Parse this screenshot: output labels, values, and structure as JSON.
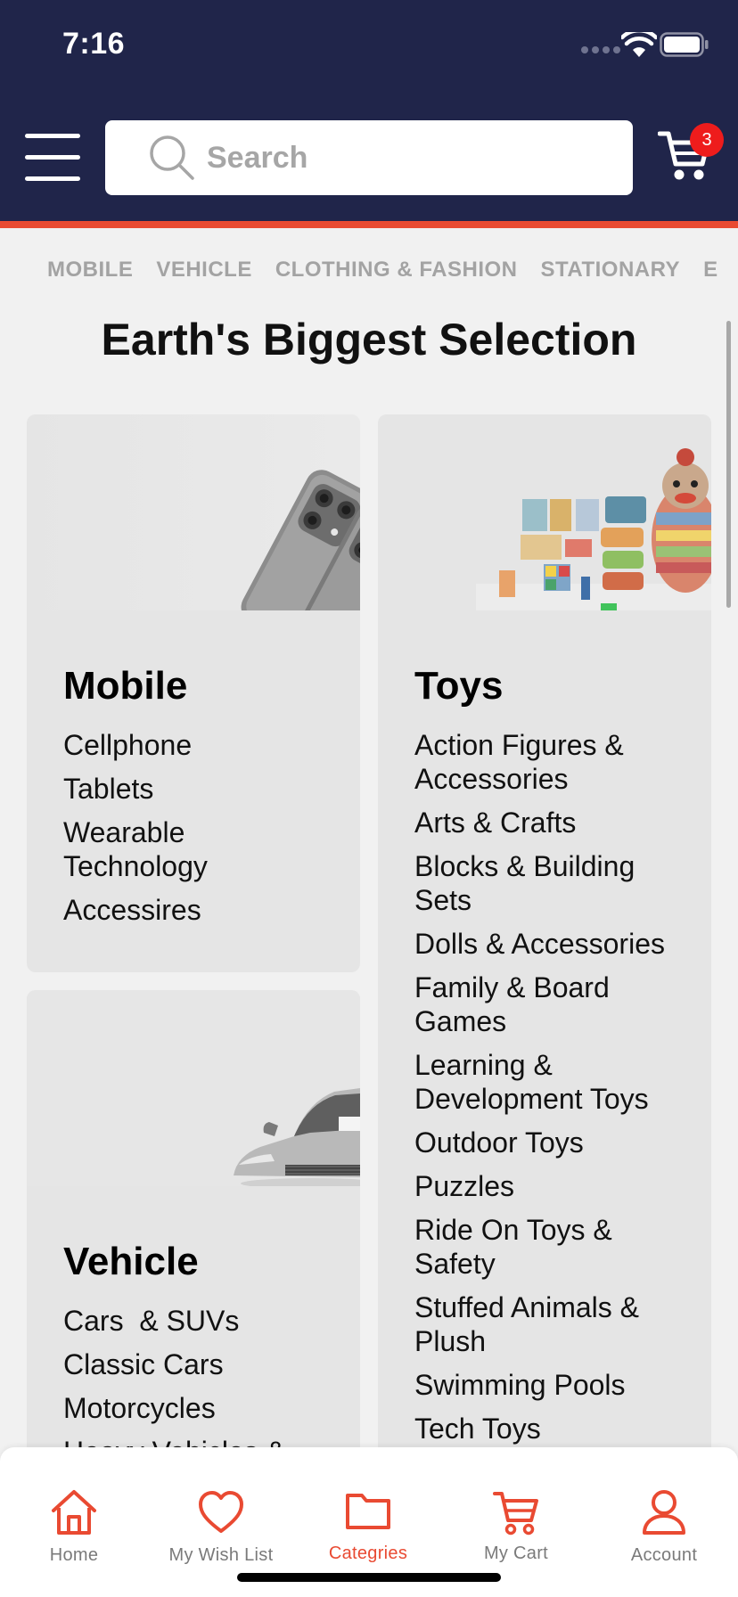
{
  "status_bar": {
    "time": "7:16"
  },
  "header": {
    "search_placeholder": "Search",
    "cart_count": "3"
  },
  "category_tabs": [
    "MOBILE",
    "VEHICLE",
    "CLOTHING & FASHION",
    "STATIONARY",
    "E"
  ],
  "page_title": "Earth's Biggest Selection",
  "cards": {
    "mobile": {
      "title": "Mobile",
      "items": [
        "Cellphone",
        "Tablets",
        "Wearable Technology",
        "Accessires"
      ]
    },
    "toys": {
      "title": "Toys",
      "items": [
        "Action Figures & Accessories",
        "Arts & Crafts",
        "Blocks & Building Sets",
        "Dolls & Accessories",
        "Family & Board Games",
        "Learning & Development Toys",
        "Outdoor Toys",
        "Puzzles",
        "Ride On Toys & Safety",
        "Stuffed Animals & Plush",
        "Swimming Pools",
        "Tech Toys"
      ]
    },
    "vehicle": {
      "title": "Vehicle",
      "items": [
        "Cars  & SUVs",
        "Classic Cars",
        "Motorcycles",
        "Heavy Vehicles &"
      ]
    }
  },
  "bottom_nav": [
    {
      "label": "Home",
      "icon": "home-icon"
    },
    {
      "label": "My Wish List",
      "icon": "heart-icon"
    },
    {
      "label": "Categries",
      "icon": "folder-icon",
      "active": true
    },
    {
      "label": "My Cart",
      "icon": "cart-icon"
    },
    {
      "label": "Account",
      "icon": "user-icon"
    }
  ],
  "colors": {
    "header_bg": "#20254a",
    "accent": "#e94a32",
    "badge": "#ee1c1c"
  }
}
